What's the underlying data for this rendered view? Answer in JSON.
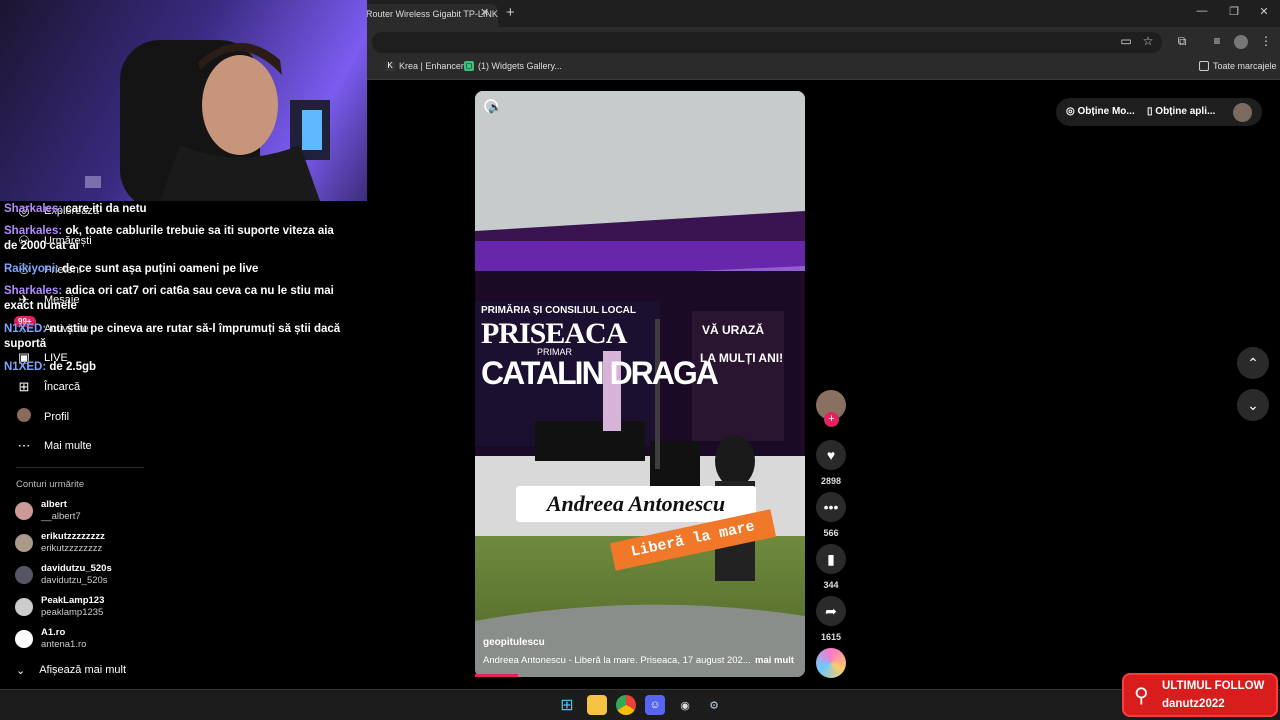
{
  "browser": {
    "tab_title": "Router Wireless Gigabit TP-LINK",
    "bookmarks": [
      "Krea | Enhancer",
      "(1) Widgets Gallery...",
      "Toate marcajele"
    ]
  },
  "sidebar": {
    "items": [
      {
        "label": "Explorează",
        "icon": "compass-icon"
      },
      {
        "label": "Urmărești",
        "icon": "users-icon"
      },
      {
        "label": "Prieteni",
        "icon": "friends-icon"
      },
      {
        "label": "Mesaje",
        "icon": "message-icon",
        "badge": "99+"
      },
      {
        "label": "Activitate",
        "icon": "activity-icon"
      },
      {
        "label": "LIVE",
        "icon": "live-icon"
      },
      {
        "label": "Încarcă",
        "icon": "upload-icon"
      },
      {
        "label": "Profil",
        "icon": "profile-icon"
      },
      {
        "label": "Mai multe",
        "icon": "more-icon"
      }
    ],
    "following_title": "Conturi urmărite",
    "accounts": [
      {
        "name": "albert",
        "handle": "__albert7"
      },
      {
        "name": "erikutzzzzzzzz",
        "handle": "erikutzzzzzzzz"
      },
      {
        "name": "davidutzu_520s",
        "handle": "davidutzu_520s"
      },
      {
        "name": "PeakLamp123",
        "handle": "peaklamp1235"
      },
      {
        "name": "A1.ro",
        "handle": "antena1.ro"
      }
    ],
    "show_more": "Afișează mai mult"
  },
  "chat": [
    {
      "user": "Sharkales:",
      "text": "care iti da netu",
      "color": "#b58cff"
    },
    {
      "user": "Sharkales:",
      "text": "ok, toate cablurile trebuie sa iti suporte viteza aia de 2000 cat ai",
      "color": "#b58cff"
    },
    {
      "user": "Raikiyoni:",
      "text": "de ce sunt așa puțini oameni pe live",
      "color": "#7aa5ff"
    },
    {
      "user": "Sharkales:",
      "text": "adica ori cat7 ori cat6a sau ceva ca nu le stiu mai exact numele",
      "color": "#b58cff"
    },
    {
      "user": "N1XED:",
      "text": "nu știu pe cineva are rutar să-l împrumuți să știi dacă suportă",
      "color": "#7aa5ff"
    },
    {
      "user": "N1XED:",
      "text": "de 2.5gb",
      "color": "#7aa5ff"
    }
  ],
  "video": {
    "banner1": "PRIMĂRIA ȘI CONSILIUL LOCAL",
    "banner2": "PRISEACA",
    "banner3": "PRIMAR",
    "banner4": "CATALIN DRAGA",
    "banner5": "VĂ URAZĂ",
    "banner6": "LA MULȚI ANI!",
    "caption_name": "Andreea Antonescu",
    "caption_song": "Liberă la mare",
    "author": "geopitulescu",
    "description": "Andreea Antonescu - Liberă la mare. Priseaca, 17 august 202...",
    "more": "mai mult",
    "progress": 0.13
  },
  "actions": {
    "likes": "2898",
    "comments": "566",
    "saves": "344",
    "shares": "1615"
  },
  "topbar": {
    "btn1": "Obține Mo...",
    "btn2": "Obține apli..."
  },
  "alert": {
    "title": "ULTIMUL FOLLOW",
    "user": "danutz2022"
  }
}
